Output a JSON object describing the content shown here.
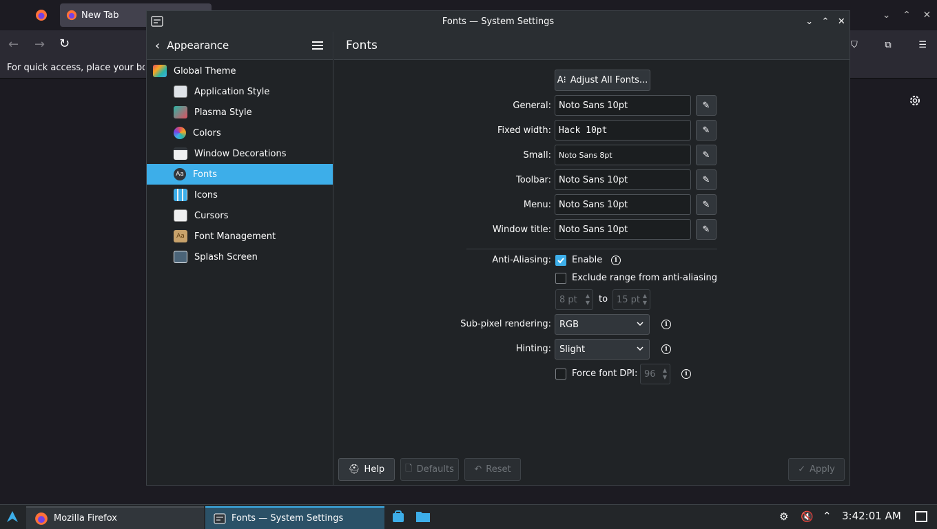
{
  "firefox": {
    "tab_title": "New Tab",
    "bookmarks_hint": "For quick access, place your boo"
  },
  "window": {
    "title": "Fonts — System Settings"
  },
  "sidebar": {
    "back_label": "Appearance",
    "items": [
      {
        "label": "Global Theme",
        "color": "#e04f5f"
      },
      {
        "label": "Application Style",
        "color": "#dfe3e8"
      },
      {
        "label": "Plasma Style",
        "color": "#2bb5a5"
      },
      {
        "label": "Colors",
        "color": "#f6a623"
      },
      {
        "label": "Window Decorations",
        "color": "#eff0f1"
      },
      {
        "label": "Fonts",
        "color": "#31363b"
      },
      {
        "label": "Icons",
        "color": "#eff0f1"
      },
      {
        "label": "Cursors",
        "color": "#eff0f1"
      },
      {
        "label": "Font Management",
        "color": "#c8a26b"
      },
      {
        "label": "Splash Screen",
        "color": "#4b6478"
      }
    ]
  },
  "main": {
    "title": "Fonts",
    "adjust_all": "Adjust All Fonts...",
    "font_rows": [
      {
        "label": "General:",
        "value": "Noto Sans 10pt"
      },
      {
        "label": "Fixed width:",
        "value": "Hack 10pt"
      },
      {
        "label": "Small:",
        "value": "Noto Sans 8pt"
      },
      {
        "label": "Toolbar:",
        "value": "Noto Sans 10pt"
      },
      {
        "label": "Menu:",
        "value": "Noto Sans 10pt"
      },
      {
        "label": "Window title:",
        "value": "Noto Sans 10pt"
      }
    ],
    "antialias_label": "Anti-Aliasing:",
    "enable_label": "Enable",
    "exclude_label": "Exclude range from anti-aliasing",
    "range_from": "8 pt",
    "range_to_word": "to",
    "range_to": "15 pt",
    "subpixel_label": "Sub-pixel rendering:",
    "subpixel_value": "RGB",
    "hinting_label": "Hinting:",
    "hinting_value": "Slight",
    "force_dpi_label": "Force font DPI:",
    "dpi_value": "96",
    "help": "Help",
    "defaults": "Defaults",
    "reset": "Reset",
    "apply": "Apply"
  },
  "taskbar": {
    "firefox": "Mozilla Firefox",
    "settings": "Fonts  — System Settings",
    "clock": "3:42:01 AM"
  },
  "colors": {
    "accent": "#3daee9"
  }
}
